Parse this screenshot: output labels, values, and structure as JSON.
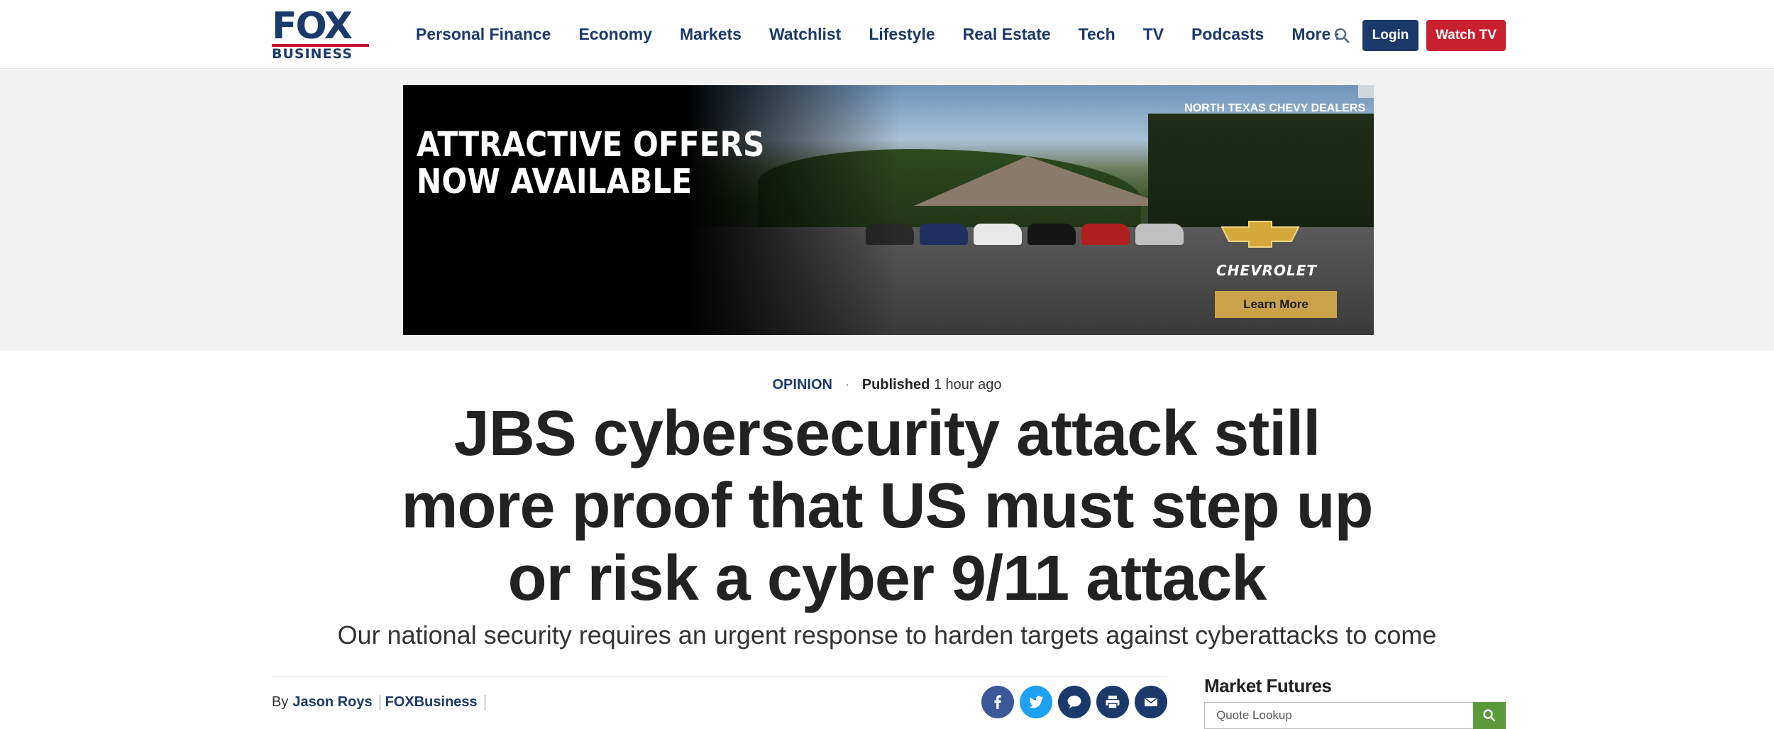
{
  "header": {
    "logo_top": "FOX",
    "logo_bottom": "BUSINESS",
    "nav": [
      "Personal Finance",
      "Economy",
      "Markets",
      "Watchlist",
      "Lifestyle",
      "Real Estate",
      "Tech",
      "TV",
      "Podcasts"
    ],
    "more_label": "More",
    "login_label": "Login",
    "watch_label": "Watch TV"
  },
  "ad": {
    "headline_line1": "ATTRACTIVE OFFERS",
    "headline_line2": "NOW AVAILABLE",
    "dealer": "NORTH TEXAS CHEVY DEALERS",
    "brand": "CHEVROLET",
    "cta": "Learn More"
  },
  "article": {
    "category": "OPINION",
    "published_label": "Published",
    "published_time": "1 hour ago",
    "headline": "JBS cybersecurity attack still more proof that US must step up or risk a cyber 9/11 attack",
    "dek": "Our national security requires an urgent response to harden targets against cyberattacks to come",
    "by_label": "By",
    "author": "Jason Roys",
    "source": "FOXBusiness"
  },
  "sidebar": {
    "market_title": "Market Futures",
    "quote_placeholder": "Quote Lookup"
  },
  "colors": {
    "brand_navy": "#1b3a6b",
    "watch_red": "#c8202f",
    "facebook": "#3b5998",
    "twitter": "#1da1f2",
    "comments": "#1b3a6b",
    "print": "#1b3a6b",
    "email": "#1b3a6b",
    "search_green": "#5a9a3a"
  },
  "icons": [
    "search-icon",
    "facebook-icon",
    "twitter-icon",
    "comment-icon",
    "print-icon",
    "email-icon"
  ]
}
